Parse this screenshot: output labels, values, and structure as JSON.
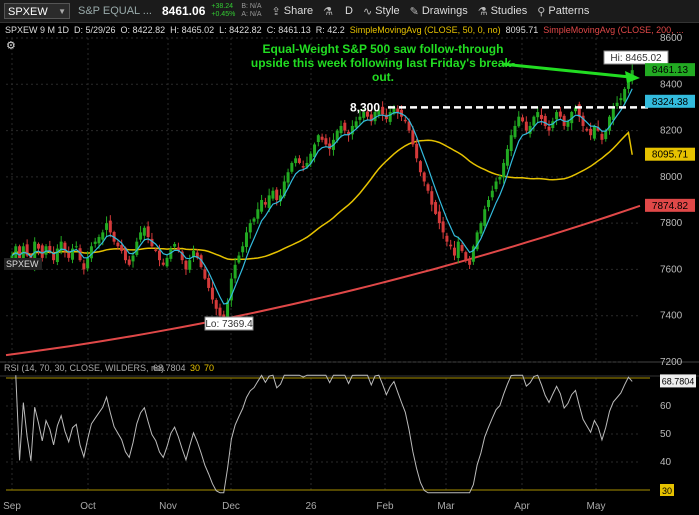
{
  "toolbar": {
    "symbol": "SPXEW",
    "name": "S&P EQUAL ...",
    "last": "8461.06",
    "change": "+38.24",
    "change_pct": "+0.45%",
    "bid": "B: N/A",
    "ask": "A: N/A",
    "share": "Share",
    "aggregation": "D",
    "style": "Style",
    "drawings": "Drawings",
    "studies": "Studies",
    "patterns": "Patterns"
  },
  "infobar": {
    "main": "SPXEW 9 M 1D",
    "date": "D: 5/29/26",
    "open": "O: 8422.82",
    "high": "H: 8465.02",
    "low": "L: 8422.82",
    "close": "C: 8461.13",
    "r": "R: 42.2",
    "sma50_label": "SimpleMovingAvg (CLOSE, 50, 0, no)",
    "sma50_value": "8095.71",
    "sma200_label": "SimpleMovingAvg (CLOSE, 200, ..."
  },
  "labels": {
    "panel_symbol": "SPXEW",
    "rsi_header": "RSI (14, 70, 30, CLOSE, WILDERS, no)",
    "rsi_value": "68.7804",
    "rsi_ob": "30",
    "rsi_os": "70",
    "annotation": "Equal-Weight S&P 500 saw follow-through upside this week following last Friday's break-out.",
    "level_label": "8,300",
    "hi_label": "Hi: 8465.02",
    "lo_label": "Lo: 7369.4"
  },
  "colors": {
    "background": "#000000",
    "up": "#22aa22",
    "down": "#d43a3a",
    "sma50": "#e6c200",
    "sma200": "#e04848",
    "ema": "#33bbdd",
    "rsi": "#bbbbbb",
    "annotation": "#22dd22"
  },
  "chart_data": [
    {
      "type": "candlestick",
      "title": "SPXEW 9 M 1D",
      "x": [
        "Sep",
        "Oct",
        "Nov",
        "Dec",
        "26",
        "Feb",
        "Mar",
        "Apr",
        "May"
      ],
      "ylim": [
        7200,
        8600
      ],
      "yticks": [
        7200,
        7400,
        7600,
        7800,
        8000,
        8200,
        8400,
        8600
      ],
      "price_closes": [
        7660,
        7700,
        7640,
        7700,
        7660,
        7620,
        7720,
        7690,
        7650,
        7700,
        7680,
        7640,
        7690,
        7720,
        7680,
        7650,
        7690,
        7700,
        7640,
        7600,
        7650,
        7700,
        7720,
        7740,
        7760,
        7800,
        7760,
        7720,
        7700,
        7680,
        7640,
        7620,
        7660,
        7720,
        7760,
        7780,
        7740,
        7700,
        7680,
        7640,
        7620,
        7650,
        7690,
        7710,
        7680,
        7640,
        7600,
        7640,
        7680,
        7650,
        7610,
        7560,
        7520,
        7470,
        7430,
        7400,
        7380,
        7460,
        7560,
        7620,
        7660,
        7700,
        7760,
        7800,
        7820,
        7860,
        7900,
        7880,
        7920,
        7940,
        7900,
        7920,
        7980,
        8020,
        8060,
        8080,
        8060,
        8040,
        8060,
        8100,
        8140,
        8180,
        8160,
        8140,
        8120,
        8160,
        8200,
        8220,
        8200,
        8180,
        8220,
        8240,
        8260,
        8280,
        8260,
        8240,
        8280,
        8290,
        8270,
        8250,
        8280,
        8300,
        8280,
        8260,
        8240,
        8200,
        8140,
        8080,
        8020,
        7980,
        7940,
        7880,
        7840,
        7800,
        7760,
        7720,
        7700,
        7660,
        7720,
        7680,
        7640,
        7620,
        7700,
        7760,
        7800,
        7860,
        7900,
        7940,
        7980,
        8000,
        8060,
        8120,
        8180,
        8220,
        8260,
        8240,
        8200,
        8220,
        8260,
        8280,
        8250,
        8220,
        8200,
        8240,
        8280,
        8260,
        8220,
        8240,
        8280,
        8300,
        8260,
        8220,
        8200,
        8180,
        8220,
        8200,
        8160,
        8200,
        8260,
        8300,
        8320,
        8340,
        8380,
        8420,
        8461
      ],
      "sma50_from_to": [
        7550,
        8095.71
      ],
      "sma200_from_to": [
        7230,
        7874.82
      ],
      "hi": 8465.02,
      "lo": 7369.4,
      "resistance": 8300,
      "price_labels": [
        {
          "value": 8461.13,
          "color": "#22aa22"
        },
        {
          "value": 8324.38,
          "color": "#33bbdd"
        },
        {
          "value": 8095.71,
          "color": "#e6c200"
        },
        {
          "value": 7874.82,
          "color": "#e04848"
        }
      ]
    },
    {
      "type": "line",
      "title": "RSI (14, 70, 30, CLOSE, WILDERS, no)",
      "ylim": [
        30,
        70
      ],
      "yticks": [
        40,
        50,
        60
      ],
      "last": 68.7804
    }
  ]
}
